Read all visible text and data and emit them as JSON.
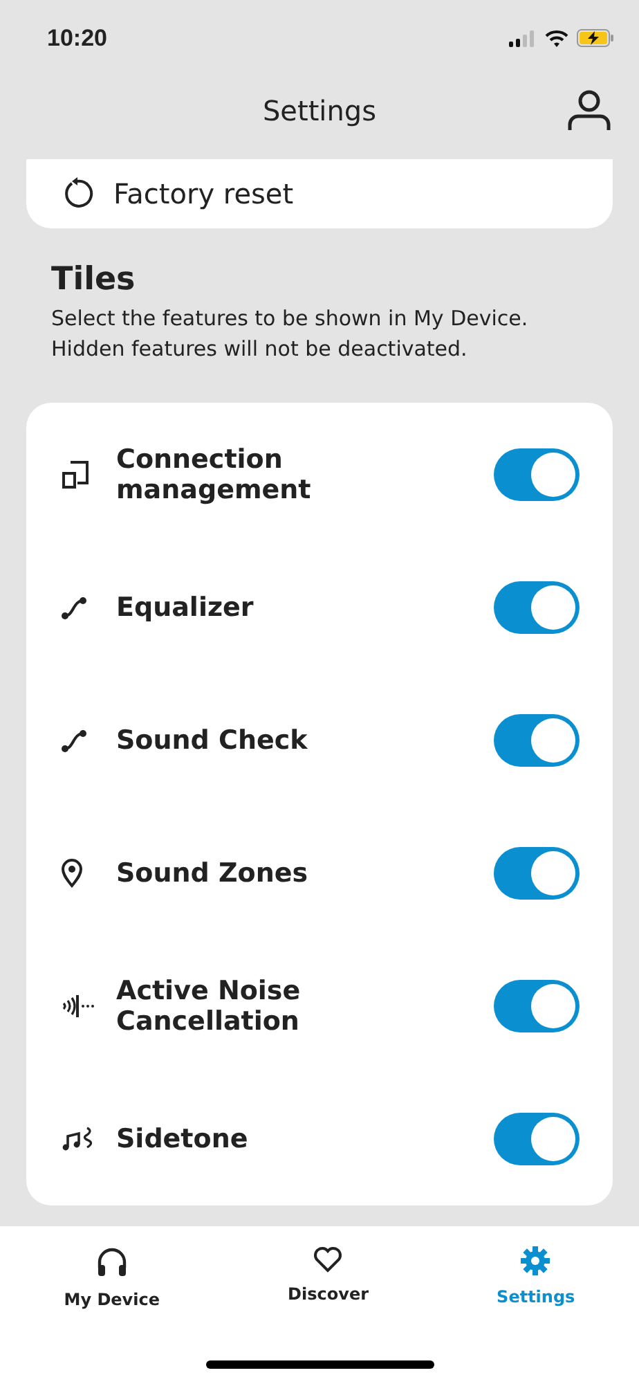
{
  "status_bar": {
    "time": "10:20"
  },
  "header": {
    "title": "Settings"
  },
  "factory_reset": {
    "label": "Factory reset"
  },
  "tiles_section": {
    "title": "Tiles",
    "description": "Select the features to be shown in My Device. Hidden features will not be deactivated."
  },
  "tiles": [
    {
      "kind": "device",
      "label": "Connection management",
      "on": true
    },
    {
      "kind": "curve",
      "label": "Equalizer",
      "on": true
    },
    {
      "kind": "curve",
      "label": "Sound Check",
      "on": true
    },
    {
      "kind": "pin",
      "label": "Sound Zones",
      "on": true
    },
    {
      "kind": "noise",
      "label": "Active Noise Cancellation",
      "on": true
    },
    {
      "kind": "music",
      "label": "Sidetone",
      "on": true
    }
  ],
  "tab_bar": [
    {
      "kind": "headphones",
      "label": "My Device",
      "selected": false
    },
    {
      "kind": "heart",
      "label": "Discover",
      "selected": false
    },
    {
      "kind": "gear",
      "label": "Settings",
      "selected": true
    }
  ]
}
